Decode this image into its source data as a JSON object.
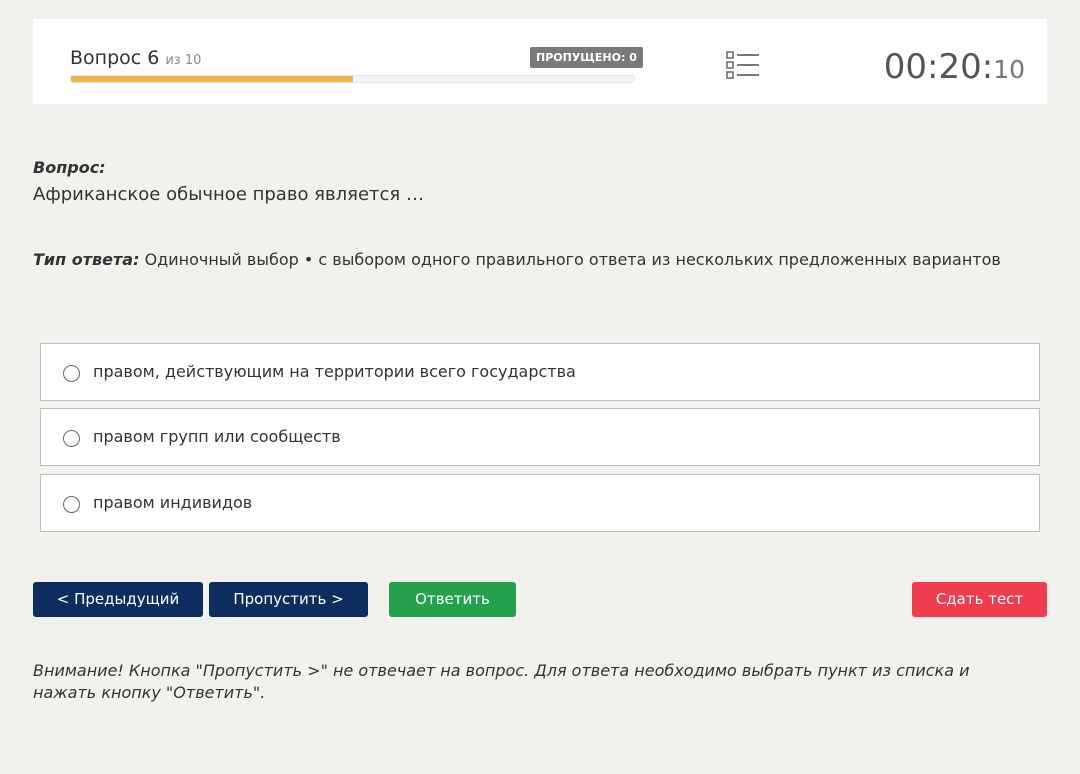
{
  "header": {
    "question_label": "Вопрос 6",
    "question_of": "из 10",
    "progress_fraction": 0.5,
    "skipped_badge": "ПРОПУЩЕНО: 0",
    "list_icon": "list-icon",
    "timer_main": "00:20:",
    "timer_seconds": "10"
  },
  "question": {
    "label": "Вопрос:",
    "text": "Африканское обычное право является …",
    "answer_type_label": "Тип ответа:",
    "answer_type_text": "Одиночный выбор • с выбором одного правильного ответа из нескольких предложенных вариантов"
  },
  "options": [
    {
      "label": "правом, действующим на территории всего государства"
    },
    {
      "label": "правом групп или сообществ"
    },
    {
      "label": "правом индивидов"
    }
  ],
  "buttons": {
    "prev": "< Предыдущий",
    "skip": "Пропустить >",
    "answer": "Ответить",
    "submit": "Сдать тест"
  },
  "warning": "Внимание! Кнопка \"Пропустить >\" не отвечает на вопрос. Для ответа необходимо выбрать пункт из списка и нажать кнопку \"Ответить\".",
  "colors": {
    "background": "#f2f1ed",
    "progress": "#f0b24a",
    "nav_button": "#0d2d5e",
    "answer_button": "#25a04c",
    "submit_button": "#f13c4f",
    "badge": "#7a7a7a"
  }
}
